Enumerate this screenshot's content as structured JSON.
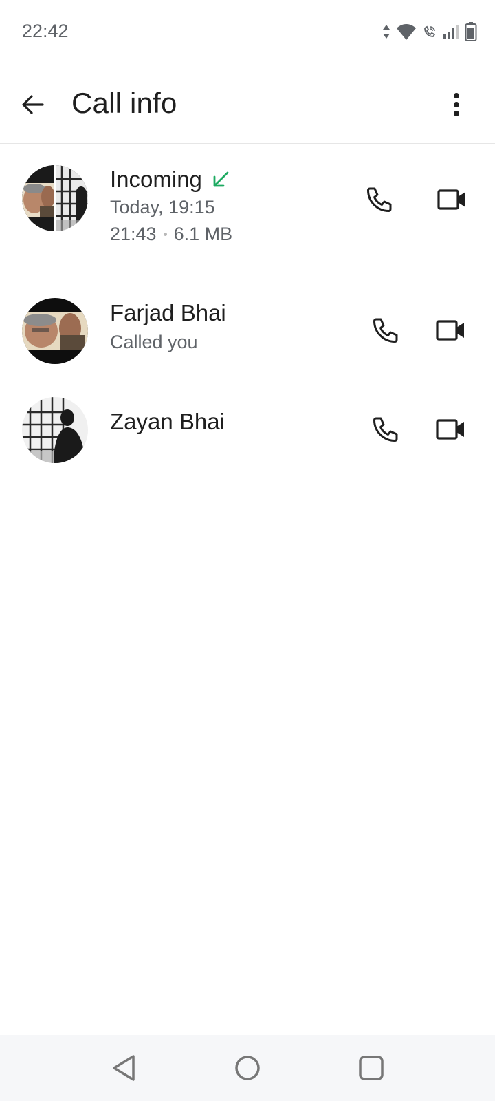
{
  "status_bar": {
    "time": "22:42",
    "icons": [
      "data-arrows-icon",
      "wifi-icon",
      "wifi-calling-icon",
      "signal-icon",
      "battery-icon"
    ]
  },
  "app_bar": {
    "title": "Call info",
    "back_icon": "arrow-left-icon",
    "more_icon": "more-vertical-icon"
  },
  "call_summary": {
    "direction": "Incoming",
    "direction_icon": "incoming-arrow-icon",
    "direction_color": "#1daa61",
    "date": "Today, 19:15",
    "duration": "21:43",
    "size": "6.1 MB"
  },
  "participants": [
    {
      "name": "Farjad Bhai",
      "status": "Called you"
    },
    {
      "name": "Zayan Bhai",
      "status": ""
    }
  ],
  "colors": {
    "text_primary": "#1f1f1f",
    "text_secondary": "#5f6368",
    "divider": "#e6e6e6",
    "incoming_green": "#1daa61",
    "nav_bg": "#f6f7f9"
  }
}
